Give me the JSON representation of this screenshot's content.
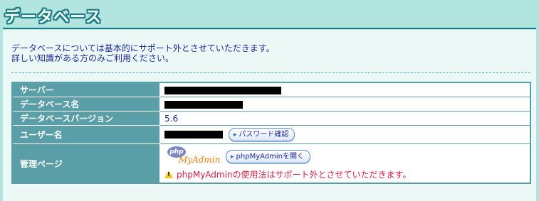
{
  "page": {
    "title": "データベース",
    "description_line1": "データベースについては基本的にサポート外とさせていただきます。",
    "description_line2": "詳しい知識がある方のみご利用ください。"
  },
  "table": {
    "server_label": "サーバー",
    "db_name_label": "データベース名",
    "db_version_label": "データベースバージョン",
    "db_version_value": "5.6",
    "user_label": "ユーザー名",
    "password_button": "パスワード確認",
    "admin_label": "管理ページ",
    "phpmyadmin_logo_php": "php",
    "phpmyadmin_logo_text": "MyAdmin",
    "phpmyadmin_button": "phpMyAdminを開く",
    "warning_text": "phpMyAdminの使用法はサポート外とさせていただきます。"
  },
  "colors": {
    "page_bg": "#b3e5e0",
    "content_bg": "#ebf8f6",
    "header_cell": "#5a9ea7",
    "title_outline": "#1a7f86",
    "text_blue": "#1e2a9b",
    "warning_red": "#d4204a"
  }
}
